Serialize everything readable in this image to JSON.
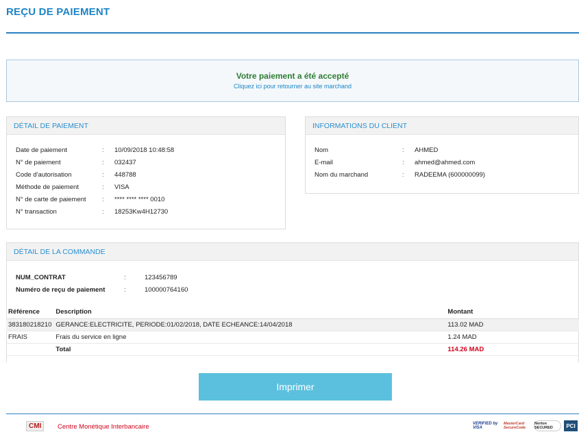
{
  "header": {
    "title": "REÇU DE PAIEMENT"
  },
  "alert": {
    "title": "Votre paiement a été accepté",
    "link": "Cliquez ici pour retourner au site marchand"
  },
  "payment": {
    "heading": "DÉTAIL DE PAIEMENT",
    "rows": [
      {
        "label": "Date de paiement",
        "value": "10/09/2018 10:48:58"
      },
      {
        "label": "N° de paiement",
        "value": "032437"
      },
      {
        "label": "Code d'autorisation",
        "value": "448788"
      },
      {
        "label": "Méthode de paiement",
        "value": "VISA"
      },
      {
        "label": "N° de carte de paiement",
        "value": "**** **** **** 0010"
      },
      {
        "label": "N° transaction",
        "value": "18253Kw4H12730"
      }
    ]
  },
  "client": {
    "heading": "INFORMATIONS DU CLIENT",
    "rows": [
      {
        "label": "Nom",
        "value": "AHMED"
      },
      {
        "label": "E-mail",
        "value": "ahmed@ahmed.com"
      },
      {
        "label": "Nom du marchand",
        "value": "RADEEMA (600000099)"
      }
    ]
  },
  "order": {
    "heading": "DÉTAIL DE LA COMMANDE",
    "rows": [
      {
        "label": "NUM_CONTRAT",
        "value": "123456789"
      },
      {
        "label": "Numéro de reçu de paiement",
        "value": "100000764160"
      }
    ],
    "columns": {
      "ref": "Référence",
      "desc": "Description",
      "amount": "Montant"
    },
    "items": [
      {
        "ref": "383180218210",
        "desc": "GERANCE:ELECTRICITE, PERIODE:01/02/2018, DATE ECHEANCE:14/04/2018",
        "amount": "113.02 MAD"
      },
      {
        "ref": "FRAIS",
        "desc": "Frais du service en ligne",
        "amount": "1.24 MAD"
      }
    ],
    "total_label": "Total",
    "total_amount": "114.26 MAD"
  },
  "actions": {
    "print": "Imprimer"
  },
  "footer": {
    "cmi_logo": "CMI",
    "cmi_text": "Centre Monétique Interbancaire",
    "badges": [
      "VERIFIED by VISA",
      "MasterCard SecureCode",
      "Norton SECURED",
      "PCI"
    ]
  },
  "sep": ":"
}
